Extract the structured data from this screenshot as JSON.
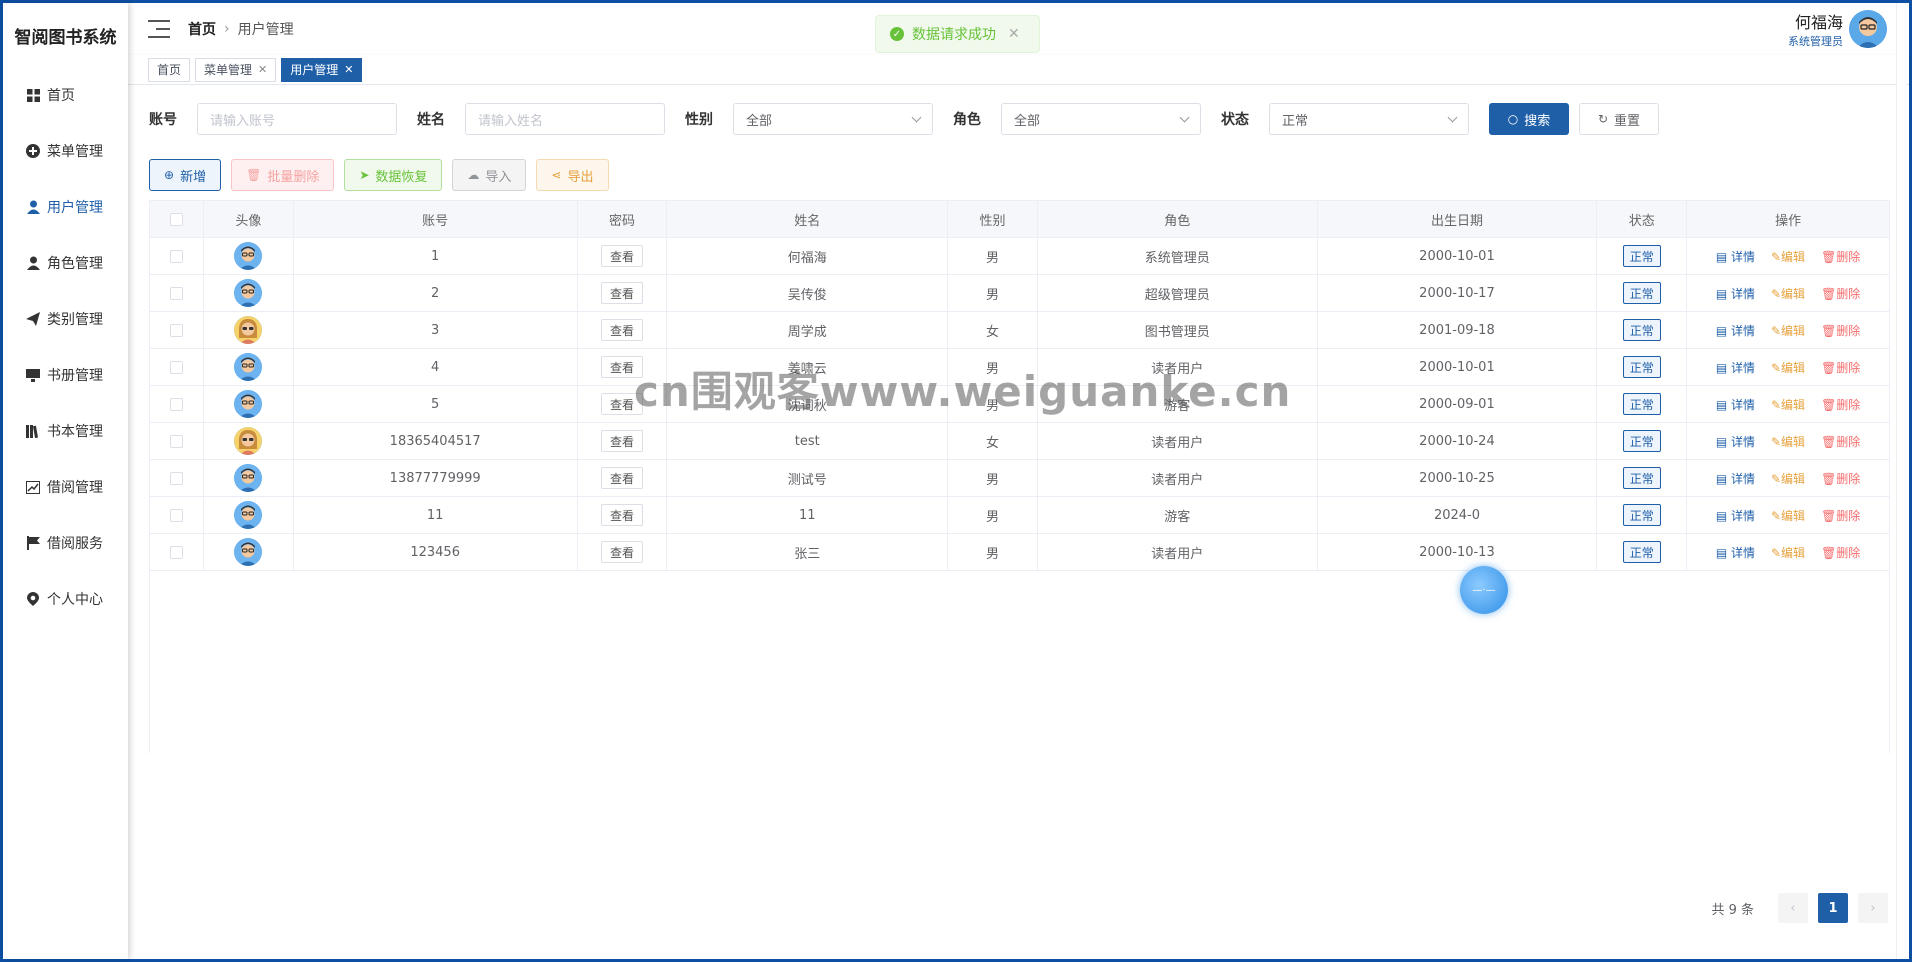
{
  "app": {
    "brand": "智阅图书系统"
  },
  "sidebar": {
    "items": [
      {
        "label": "首页",
        "icon": "grid-icon"
      },
      {
        "label": "菜单管理",
        "icon": "plus-circle-icon"
      },
      {
        "label": "用户管理",
        "icon": "user-icon",
        "active": true
      },
      {
        "label": "角色管理",
        "icon": "user-icon"
      },
      {
        "label": "类别管理",
        "icon": "paper-plane-icon"
      },
      {
        "label": "书册管理",
        "icon": "monitor-icon"
      },
      {
        "label": "书本管理",
        "icon": "books-icon"
      },
      {
        "label": "借阅管理",
        "icon": "chart-icon"
      },
      {
        "label": "借阅服务",
        "icon": "flag-icon"
      },
      {
        "label": "个人中心",
        "icon": "location-icon"
      }
    ]
  },
  "header": {
    "breadcrumb": [
      "首页",
      "用户管理"
    ],
    "user_name": "何福海",
    "user_role": "系统管理员"
  },
  "toast": {
    "text": "数据请求成功"
  },
  "tags": [
    {
      "label": "首页",
      "closable": false
    },
    {
      "label": "菜单管理",
      "closable": true
    },
    {
      "label": "用户管理",
      "closable": true,
      "active": true
    }
  ],
  "filters": {
    "account_label": "账号",
    "account_placeholder": "请输入账号",
    "name_label": "姓名",
    "name_placeholder": "请输入姓名",
    "gender_label": "性别",
    "gender_value": "全部",
    "role_label": "角色",
    "role_value": "全部",
    "status_label": "状态",
    "status_value": "正常",
    "search_label": "搜索",
    "reset_label": "重置"
  },
  "actions": {
    "add": "新增",
    "batch_delete": "批量删除",
    "restore": "数据恢复",
    "import": "导入",
    "export": "导出"
  },
  "table": {
    "columns": [
      "头像",
      "账号",
      "密码",
      "姓名",
      "性别",
      "角色",
      "出生日期",
      "状态",
      "操作"
    ],
    "view_label": "查看",
    "status_label": "正常",
    "op_detail": "详情",
    "op_edit": "编辑",
    "op_delete": "删除",
    "rows": [
      {
        "account": "1",
        "name": "何福海",
        "gender": "男",
        "role": "系统管理员",
        "birth": "2000-10-01",
        "avatar": "male"
      },
      {
        "account": "2",
        "name": "吴传俊",
        "gender": "男",
        "role": "超级管理员",
        "birth": "2000-10-17",
        "avatar": "male"
      },
      {
        "account": "3",
        "name": "周学成",
        "gender": "女",
        "role": "图书管理员",
        "birth": "2001-09-18",
        "avatar": "female"
      },
      {
        "account": "4",
        "name": "姜啸云",
        "gender": "男",
        "role": "读者用户",
        "birth": "2000-10-01",
        "avatar": "male"
      },
      {
        "account": "5",
        "name": "沈词秋",
        "gender": "男",
        "role": "游客",
        "birth": "2000-09-01",
        "avatar": "male"
      },
      {
        "account": "18365404517",
        "name": "test",
        "gender": "女",
        "role": "读者用户",
        "birth": "2000-10-24",
        "avatar": "female"
      },
      {
        "account": "13877779999",
        "name": "测试号",
        "gender": "男",
        "role": "读者用户",
        "birth": "2000-10-25",
        "avatar": "male"
      },
      {
        "account": "11",
        "name": "11",
        "gender": "男",
        "role": "游客",
        "birth": "2024-0",
        "avatar": "male"
      },
      {
        "account": "123456",
        "name": "张三",
        "gender": "男",
        "role": "读者用户",
        "birth": "2000-10-13",
        "avatar": "male"
      }
    ]
  },
  "pagination": {
    "total_text": "共 9 条",
    "current": "1",
    "prev": "‹",
    "next": "›"
  },
  "watermark": "cn围观客www.weiguanke.cn"
}
